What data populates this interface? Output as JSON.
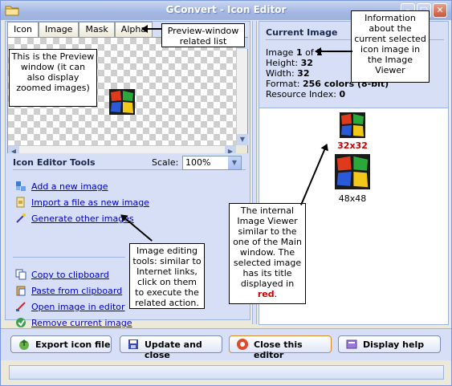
{
  "window": {
    "title": "GConvert - Icon Editor",
    "min_glyph": "–",
    "max_glyph": "□",
    "close_glyph": "✕"
  },
  "tabs": [
    {
      "label": "Icon",
      "active": true
    },
    {
      "label": "Image",
      "active": false
    },
    {
      "label": "Mask",
      "active": false
    },
    {
      "label": "Alpha",
      "active": false
    }
  ],
  "scroll_arrows": {
    "up": "▲",
    "down": "▼",
    "left": "◀",
    "right": "▶"
  },
  "tools": {
    "title": "Icon Editor Tools",
    "scale_label": "Scale:",
    "scale_value": "100%",
    "scale_dropdown_glyph": "▼",
    "items": [
      {
        "label": "Add a new image",
        "icon": "add-image-icon"
      },
      {
        "label": "Import a file as new image",
        "icon": "import-file-icon"
      },
      {
        "label": "Generate other images",
        "icon": "magic-wand-icon"
      },
      {
        "label": "Copy to clipboard",
        "icon": "copy-icon"
      },
      {
        "label": "Paste from clipboard",
        "icon": "paste-icon"
      },
      {
        "label": "Open image in editor",
        "icon": "editor-icon"
      },
      {
        "label": "Remove current image",
        "icon": "remove-icon"
      }
    ]
  },
  "current_image": {
    "title": "Current Image",
    "image_prefix": "Image ",
    "image_index": "1",
    "image_of": " of ",
    "image_total": "2",
    "height_label": "Height: ",
    "height_value": "32",
    "width_label": "Width: ",
    "width_value": "32",
    "format_label": "Format: ",
    "format_value": "256 colors (8-bit)",
    "resource_label": "Resource Index: ",
    "resource_value": "0"
  },
  "viewer": {
    "images": [
      {
        "label": "32x32",
        "selected": true
      },
      {
        "label": "48x48",
        "selected": false
      }
    ]
  },
  "buttons": [
    {
      "label": "Export icon file",
      "icon": "export-icon"
    },
    {
      "label": "Update and close",
      "icon": "save-icon"
    },
    {
      "label": "Close this editor",
      "icon": "close-editor-icon"
    },
    {
      "label": "Display help",
      "icon": "help-icon"
    }
  ],
  "callouts": {
    "tabs": "Preview-window related list",
    "preview": "This is the Preview window (it can also display zoomed images)",
    "info": "Information about the current selected icon image in the Image Viewer",
    "tools": "Image editing tools: similar to Internet links, click on them to execute the related action.",
    "viewer_main": "The internal Image Viewer similar to the one of the Main window. The selected image has its title displayed in",
    "viewer_red": "red",
    "viewer_end": "."
  },
  "colors": {
    "selected_label": "#cc0000",
    "link": "#0000cc",
    "panel": "#d6dff5"
  }
}
